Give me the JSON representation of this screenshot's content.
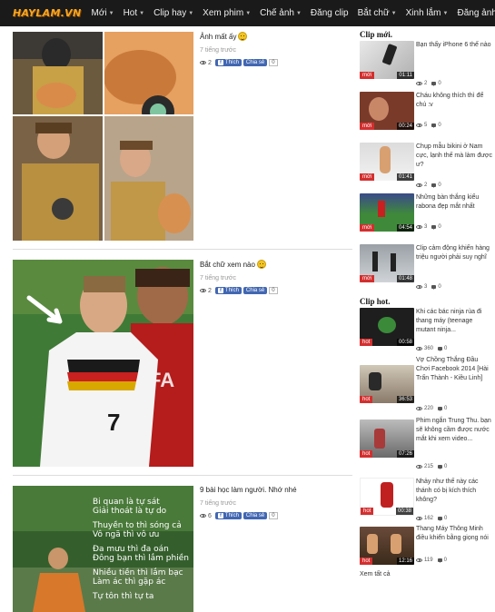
{
  "nav": {
    "logo": "HAYLAM.VN",
    "items": [
      "Mới",
      "Hot",
      "Clip hay",
      "Xem phim",
      "Chế ảnh",
      "Đăng clip",
      "Bắt chữ",
      "Xinh lắm",
      "Đăng ảnh"
    ]
  },
  "posts": [
    {
      "title": "Ảnh mất ấy",
      "time": "7 tiếng trước",
      "views": "2",
      "like_label": "Thích",
      "share_label": "Chia sẻ",
      "count": "0"
    },
    {
      "title": "Bắt chữ xem nào",
      "time": "7 tiếng trước",
      "views": "2",
      "like_label": "Thích",
      "share_label": "Chia sẻ",
      "count": "0"
    },
    {
      "title": "9 bài học làm người. Nhớ nhé",
      "time": "7 tiếng trước",
      "views": "6",
      "like_label": "Thích",
      "share_label": "Chia sẻ",
      "count": "0"
    }
  ],
  "poster_text": [
    "Bi quan là tự sát",
    "Giải thoát là tự do",
    "Thuyền to thì sóng cả",
    "Vô ngã thì vô ưu",
    "Đa mưu thì đa oán",
    "Đông bạn thì lắm phiền",
    "Nhiều tiền thì lắm bạc",
    "Làm ác thì gặp ác",
    "Tự tôn thì tự ta"
  ],
  "sidebar": {
    "clip_moi_heading": "Clip mới.",
    "clip_hot_heading": "Clip hot.",
    "clips_new": [
      {
        "title": "Bạn thấy iPhone 6 thế nào",
        "badge": "mới",
        "duration": "01:11",
        "views": "2",
        "comments": "0"
      },
      {
        "title": "Cháu không thích thì để chú :v",
        "badge": "mới",
        "duration": "00:24",
        "views": "5",
        "comments": "0"
      },
      {
        "title": "Chụp mẫu bikini ở Nam cực, lạnh thế mà làm được ư?",
        "badge": "mới",
        "duration": "01:41",
        "views": "2",
        "comments": "0"
      },
      {
        "title": "Những bàn thắng kiểu rabona đẹp mắt nhất",
        "badge": "mới",
        "duration": "04:54",
        "views": "3",
        "comments": "0"
      },
      {
        "title": "Clip cảm động khiến hàng triệu người phải suy nghĩ",
        "badge": "mới",
        "duration": "01:48",
        "views": "3",
        "comments": "0"
      }
    ],
    "clips_hot": [
      {
        "title": "Khi các bác ninja rùa đi thang máy (teenage mutant ninja...",
        "badge": "hot",
        "duration": "00:58",
        "views": "360",
        "comments": "0"
      },
      {
        "title": "Vợ Chồng Thắng Đầu Chơi Facebook 2014 [Hài Trấn Thành - Kiều Linh]",
        "badge": "hot",
        "duration": "36:53",
        "views": "220",
        "comments": "0"
      },
      {
        "title": "Phim ngắn Trung Thu. bạn sẽ không cầm được nước mắt khi xem video...",
        "badge": "hot",
        "duration": "07:26",
        "views": "215",
        "comments": "0"
      },
      {
        "title": "Nhảy như thế này các thánh có bị kích thích không?",
        "badge": "hot",
        "duration": "00:38",
        "views": "162",
        "comments": "0"
      },
      {
        "title": "Thang Máy Thông Minh điều khiển bằng giọng nói",
        "badge": "hot",
        "duration": "12:16",
        "views": "119",
        "comments": "0"
      }
    ],
    "see_all": "Xem tất cả"
  }
}
